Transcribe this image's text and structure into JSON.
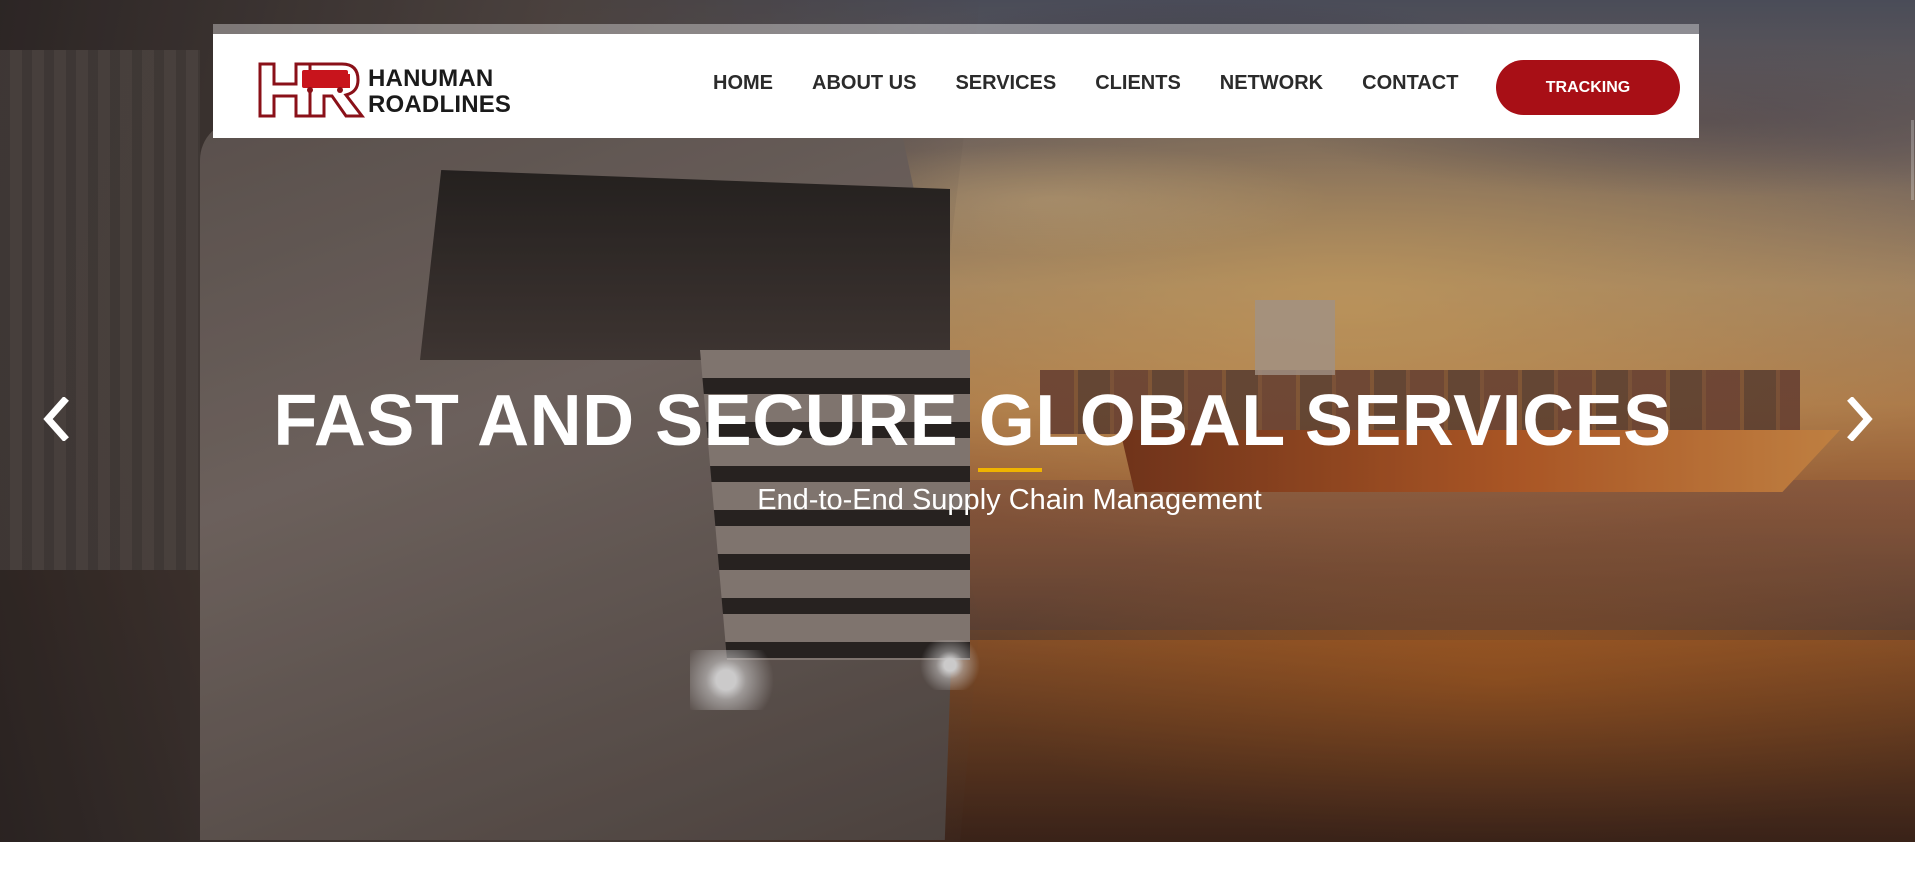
{
  "brand": {
    "logo_line1": "HANUMAN",
    "logo_line2": "ROADLINES",
    "logo_mark_letters": "HR",
    "accent_color": "#a80f16"
  },
  "nav": {
    "items": [
      {
        "label": "HOME"
      },
      {
        "label": "ABOUT US"
      },
      {
        "label": "SERVICES"
      },
      {
        "label": "CLIENTS"
      },
      {
        "label": "NETWORK"
      },
      {
        "label": "CONTACT"
      }
    ],
    "cta_label": "TRACKING"
  },
  "hero": {
    "title": "FAST AND SECURE GLOBAL SERVICES",
    "subtitle": "End-to-End Supply Chain Management",
    "divider_color": "#f0b400",
    "prev_icon": "chevron-left-icon",
    "next_icon": "chevron-right-icon"
  }
}
